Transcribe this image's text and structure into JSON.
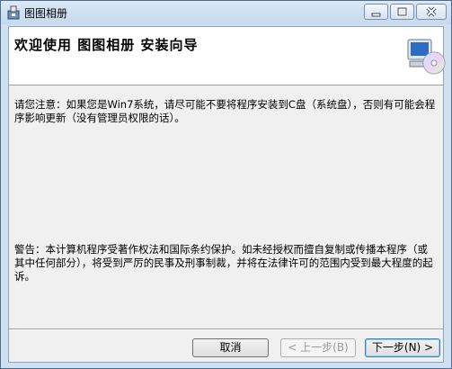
{
  "window": {
    "title": "图图相册"
  },
  "header": {
    "title": "欢迎使用  图图相册  安装向导"
  },
  "body": {
    "notice": "请您注意：如果您是Win7系统，请尽可能不要将程序安装到C盘（系统盘），否则有可能会程序影响更新（没有管理员权限的话）。",
    "warning": "警告：本计算机程序受著作权法和国际条约保护。如未经授权而擅自复制或传播本程序（或其中任何部分），将受到严厉的民事及刑事制裁，并将在法律许可的范围内受到最大程度的起诉。"
  },
  "buttons": {
    "cancel": "取消",
    "back": "< 上一步(B)",
    "next": "下一步(N) >"
  },
  "icons": {
    "app": "installer-icon",
    "header": "computer-cd-icon",
    "minimize": "minimize-icon",
    "maximize": "maximize-icon",
    "close": "close-icon"
  },
  "colors": {
    "close_button": "#c75050",
    "titlebar": "#c6d9ee"
  }
}
